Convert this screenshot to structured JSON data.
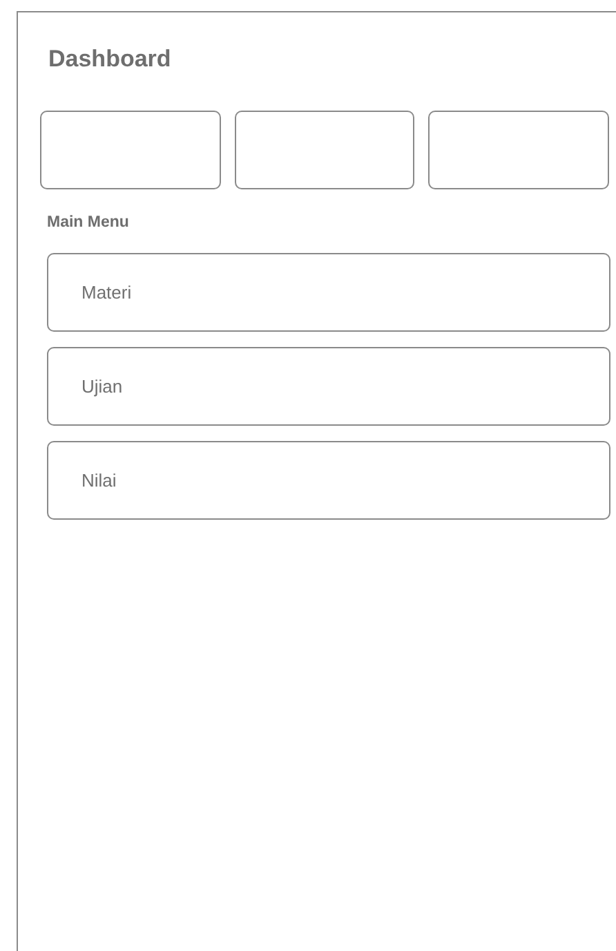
{
  "title": "Dashboard",
  "stat_cards": [
    {
      "kind": "blank"
    },
    {
      "kind": "blank"
    },
    {
      "kind": "blank"
    }
  ],
  "menu": {
    "heading": "Main Menu",
    "items": [
      {
        "label": "Materi"
      },
      {
        "label": "Ujian"
      },
      {
        "label": "Nilai"
      }
    ]
  }
}
